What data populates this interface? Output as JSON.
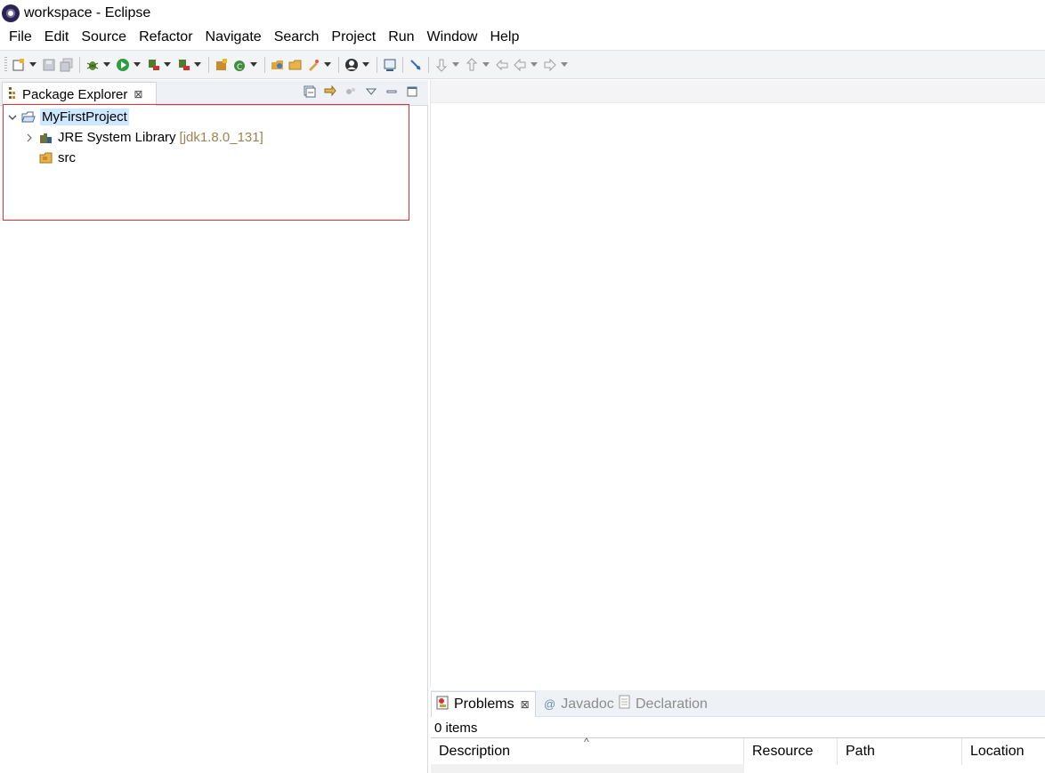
{
  "window": {
    "title": "workspace - Eclipse"
  },
  "menu": [
    "File",
    "Edit",
    "Source",
    "Refactor",
    "Navigate",
    "Search",
    "Project",
    "Run",
    "Window",
    "Help"
  ],
  "package_explorer": {
    "tab_label": "Package Explorer",
    "tree": {
      "project": "MyFirstProject",
      "jre_label": "JRE System Library",
      "jre_decoration": "[jdk1.8.0_131]",
      "src_label": "src"
    }
  },
  "bottom_panel": {
    "tabs": [
      "Problems",
      "Javadoc",
      "Declaration"
    ],
    "items_count": "0 items",
    "columns": [
      "Description",
      "Resource",
      "Path",
      "Location"
    ]
  },
  "colors": {
    "selection": "#cde8ff",
    "highlight_box": "#e23030",
    "decoration": "#9c8450"
  }
}
